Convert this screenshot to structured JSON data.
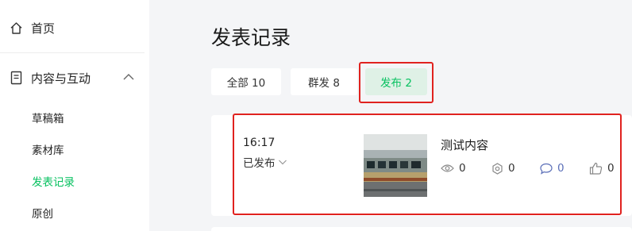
{
  "sidebar": {
    "home_label": "首页",
    "group_label": "内容与互动",
    "items": [
      {
        "label": "草稿箱"
      },
      {
        "label": "素材库"
      },
      {
        "label": "发表记录"
      },
      {
        "label": "原创"
      }
    ]
  },
  "main": {
    "title": "发表记录",
    "tabs": [
      {
        "label": "全部 10"
      },
      {
        "label": "群发 8"
      },
      {
        "label": "发布 2"
      }
    ],
    "record": {
      "time": "16:17",
      "status": "已发布",
      "title": "测试内容",
      "views": "0",
      "shares": "0",
      "comments": "0",
      "likes": "0"
    }
  },
  "colors": {
    "accent": "#07c160",
    "highlight_box": "#e0221f",
    "active_tab_bg": "#dff1e6",
    "comment_icon": "#5b6fb8"
  },
  "icons": [
    "home-icon",
    "document-icon",
    "chevron-up-icon",
    "chevron-down-icon",
    "eye-icon",
    "share-icon",
    "comment-icon",
    "thumbs-up-icon"
  ]
}
